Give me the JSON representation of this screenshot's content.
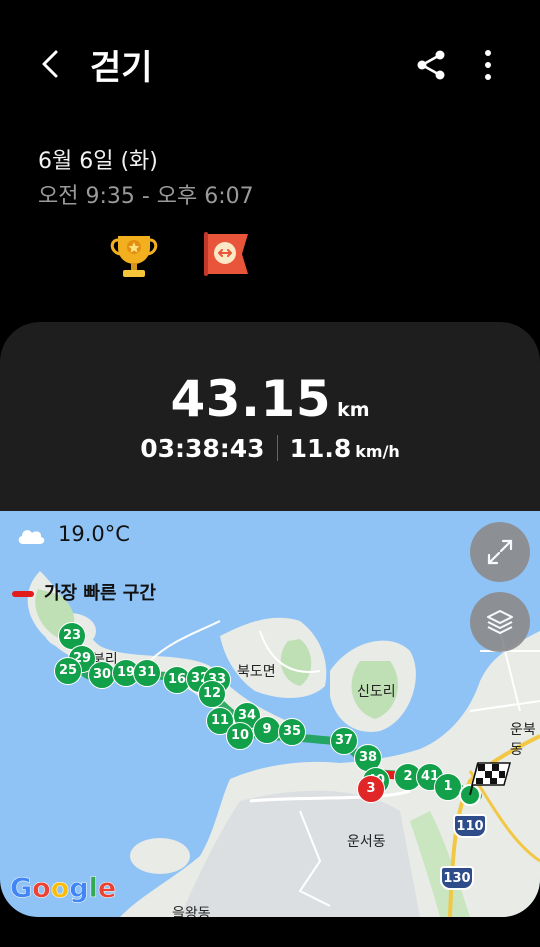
{
  "header": {
    "back_icon": "chevron-left-icon",
    "title": "걷기",
    "share_icon": "share-icon",
    "more_icon": "more-vertical-icon"
  },
  "session": {
    "date": "6월 6일 (화)",
    "time_range": "오전 9:35 - 오후 6:07",
    "badges": [
      "trophy-icon",
      "flag-badge-icon"
    ]
  },
  "summary": {
    "distance_value": "43.15",
    "distance_unit": "km",
    "duration": "03:38:43",
    "speed_value": "11.8",
    "speed_unit": "km/h"
  },
  "map": {
    "weather_icon": "cloud-icon",
    "temperature": "19.0°C",
    "legend_label": "가장 빠른 구간",
    "expand_button_icon": "expand-icon",
    "layers_button_icon": "layers-icon",
    "google_logo": "Google",
    "place_labels": [
      "북도면",
      "신도리",
      "운서동",
      "을왕동",
      "운북동",
      "북리"
    ],
    "road_shields": [
      "110",
      "130"
    ],
    "markers": [
      "23",
      "29",
      "25",
      "30",
      "19",
      "31",
      "16",
      "32",
      "33",
      "12",
      "34",
      "11",
      "10",
      "9",
      "35",
      "37",
      "38",
      "40",
      "3",
      "2",
      "41",
      "1"
    ],
    "end_icon": "checkered-flag-icon",
    "colors": {
      "route": "#13a04a",
      "fastest": "#e21b1b",
      "water": "#8fc3f5",
      "land": "#e8ebe6"
    }
  }
}
